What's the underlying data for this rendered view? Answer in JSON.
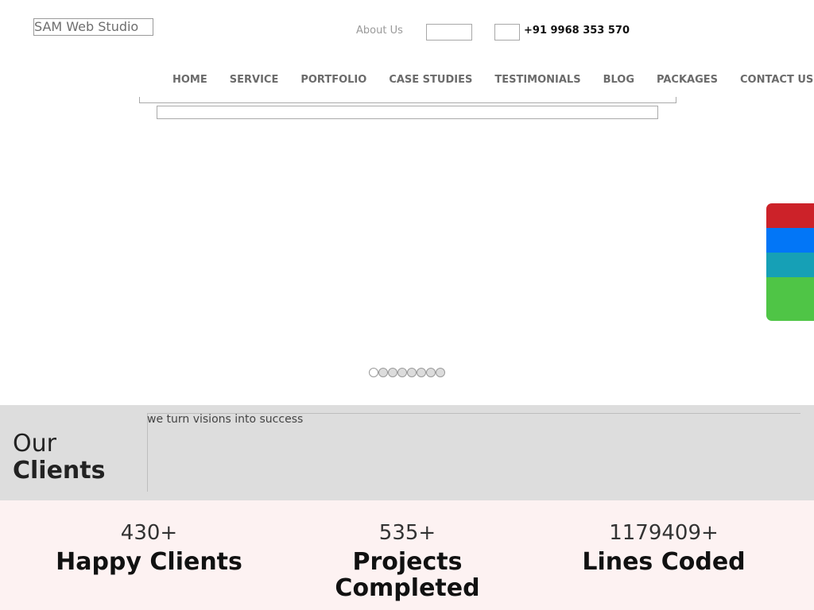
{
  "header": {
    "logo": "SAM Web Studio",
    "about_link": "About Us",
    "phone": "+91 9968 353 570"
  },
  "nav": {
    "items": [
      "HOME",
      "SERVICE",
      "PORTFOLIO",
      "CASE STUDIES",
      "TESTIMONIALS",
      "BLOG",
      "PACKAGES",
      "CONTACT US"
    ]
  },
  "social_colors": [
    "#cc2229",
    "#0276f7",
    "#16a0b6",
    "#4fc546"
  ],
  "slider": {
    "slide_count": 8,
    "active_index": 0
  },
  "clients": {
    "heading_line1": "Our",
    "heading_line2": "Clients",
    "tagline": "we turn visions into success"
  },
  "stats": [
    {
      "number": "430+",
      "label": "Happy Clients"
    },
    {
      "number": "535+",
      "label": "Projects Completed"
    },
    {
      "number": "1179409+",
      "label": "Lines Coded"
    }
  ]
}
